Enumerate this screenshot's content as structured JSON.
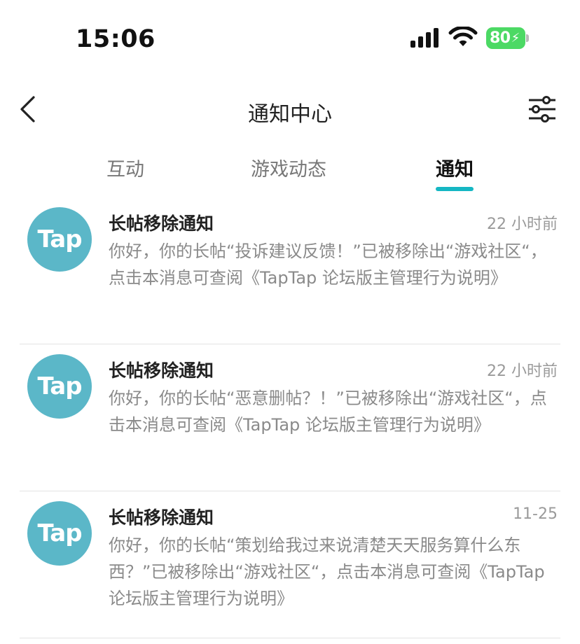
{
  "status_bar": {
    "time": "15:06",
    "battery": "80"
  },
  "nav": {
    "title": "通知中心"
  },
  "tabs": [
    {
      "label": "互动",
      "active": false
    },
    {
      "label": "游戏动态",
      "active": false
    },
    {
      "label": "通知",
      "active": true
    }
  ],
  "accent_color": "#15b7c3",
  "avatar_color": "#5bb7c8",
  "notifications": [
    {
      "avatar_text": "Tap",
      "title": "长帖移除通知",
      "time": "22 小时前",
      "body": "你好，你的长帖“投诉建议反馈！”已被移除出“游戏社区“，点击本消息可查阅《TapTap 论坛版主管理行为说明》"
    },
    {
      "avatar_text": "Tap",
      "title": "长帖移除通知",
      "time": "22 小时前",
      "body": "你好，你的长帖“恶意删帖？！”已被移除出“游戏社区“，点击本消息可查阅《TapTap 论坛版主管理行为说明》"
    },
    {
      "avatar_text": "Tap",
      "title": "长帖移除通知",
      "time": "11-25",
      "body": "你好，你的长帖“策划给我过来说清楚天天服务算什么东西？”已被移除出“游戏社区“，点击本消息可查阅《TapTap 论坛版主管理行为说明》"
    }
  ]
}
